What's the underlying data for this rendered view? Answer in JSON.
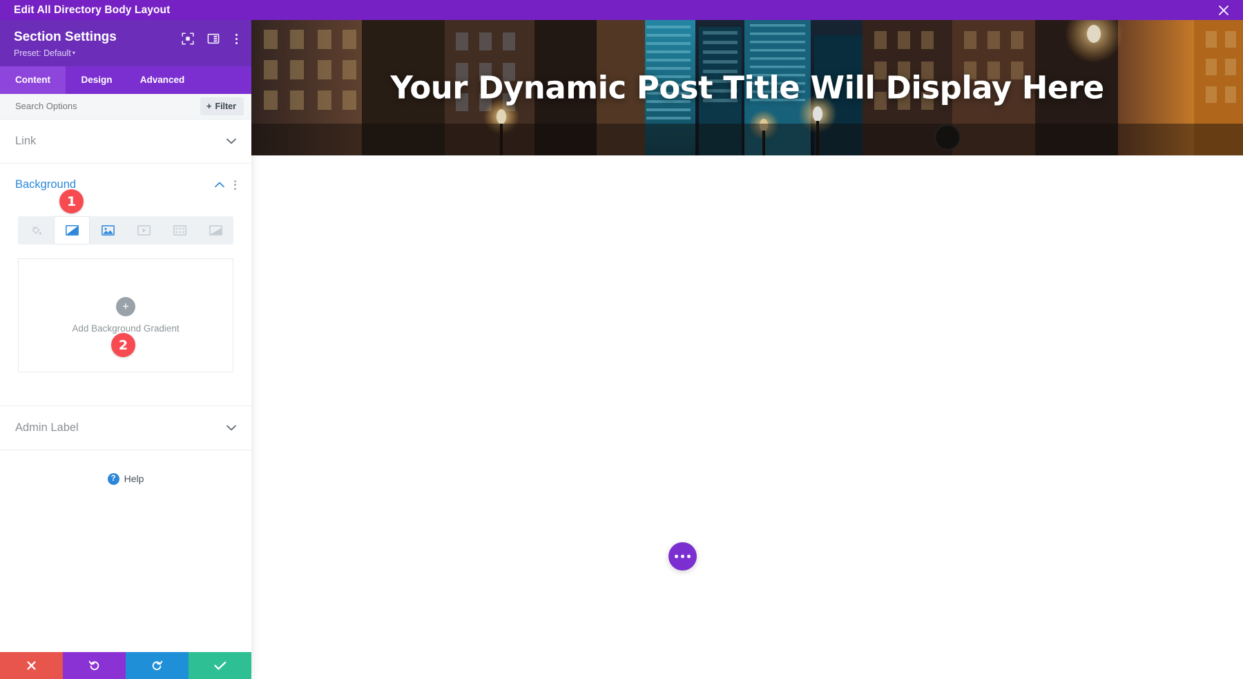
{
  "titlebar": {
    "title": "Edit All Directory Body Layout",
    "close_icon": "close-icon"
  },
  "panel": {
    "title": "Section Settings",
    "preset_label": "Preset: Default",
    "header_icons": [
      "focus-target-icon",
      "panel-layout-icon",
      "more-vertical-icon"
    ],
    "tabs": [
      {
        "label": "Content",
        "active": true
      },
      {
        "label": "Design",
        "active": false
      },
      {
        "label": "Advanced",
        "active": false
      }
    ],
    "search": {
      "placeholder": "Search Options",
      "value": ""
    },
    "filter_button": {
      "label": "Filter",
      "plus": "+"
    },
    "sections": [
      {
        "name": "link",
        "label": "Link",
        "open": false
      },
      {
        "name": "background",
        "label": "Background",
        "open": true
      },
      {
        "name": "admin-label",
        "label": "Admin Label",
        "open": false
      }
    ],
    "background": {
      "type_tabs": [
        {
          "name": "background-color",
          "icon": "paint-bucket-icon",
          "active": false
        },
        {
          "name": "background-gradient",
          "icon": "gradient-icon",
          "active": true
        },
        {
          "name": "background-image",
          "icon": "image-icon",
          "active": false
        },
        {
          "name": "background-video",
          "icon": "video-icon",
          "active": false
        },
        {
          "name": "background-pattern",
          "icon": "pattern-icon",
          "active": false
        },
        {
          "name": "background-mask",
          "icon": "mask-icon",
          "active": false
        }
      ],
      "add_gradient_label": "Add Background Gradient",
      "add_gradient_plus": "+"
    },
    "help": {
      "label": "Help",
      "icon_glyph": "?"
    },
    "action_bar": [
      {
        "name": "cancel",
        "icon": "close-icon",
        "color": "#e7554d"
      },
      {
        "name": "undo",
        "icon": "undo-icon",
        "color": "#8b32d4"
      },
      {
        "name": "redo",
        "icon": "redo-icon",
        "color": "#1f8fd8"
      },
      {
        "name": "save",
        "icon": "check-icon",
        "color": "#2fbf94"
      }
    ]
  },
  "canvas": {
    "hero_title": "Your Dynamic Post Title Will Display Here",
    "fab": {
      "name": "more-options-fab",
      "icon": "ellipsis-icon"
    }
  },
  "step_badges": [
    {
      "number": "1",
      "target": "background-section"
    },
    {
      "number": "2",
      "target": "add-background-gradient"
    }
  ],
  "colors": {
    "brand_purple": "#7621c4",
    "panel_header_purple": "#6c2eb9",
    "tab_purple": "#7b2fd0",
    "tab_active_purple": "#8e45db",
    "accent_blue": "#2b87da",
    "badge_red": "#f74b51"
  }
}
